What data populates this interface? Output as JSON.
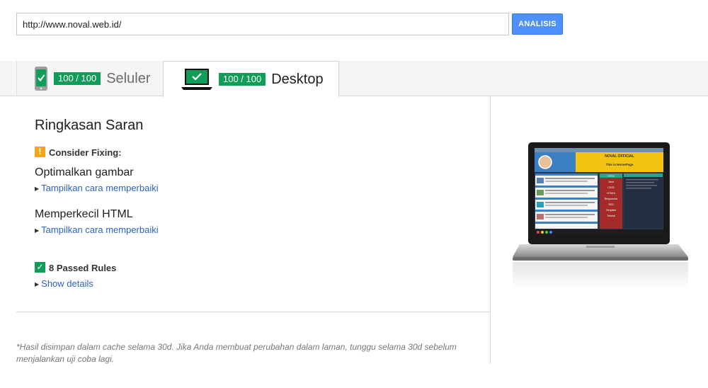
{
  "url_bar": {
    "value": "http://www.noval.web.id/",
    "analyze_label": "ANALISIS"
  },
  "tabs": [
    {
      "id": "mobile",
      "score": "100 / 100",
      "label": "Seluler",
      "active": false
    },
    {
      "id": "desktop",
      "score": "100 / 100",
      "label": "Desktop",
      "active": true
    }
  ],
  "summary": {
    "title": "Ringkasan Saran",
    "consider_label": "Consider Fixing:",
    "rules": [
      {
        "title": "Optimalkan gambar",
        "link": "Tampilkan cara memperbaiki"
      },
      {
        "title": "Memperkecil HTML",
        "link": "Tampilkan cara memperbaiki"
      }
    ],
    "passed_label": "8 Passed Rules",
    "show_details": "Show details"
  },
  "cache_note": "*Hasil disimpan dalam cache selama 30d. Jika Anda membuat perubahan dalam laman, tunggu selama 30d sebelum menjalankan uji coba lagi.",
  "preview_screen": {
    "site_title": "NOVAL OFFICIAL",
    "page_heading": "This is HomePage",
    "nav_items": [
      "Home",
      "Java",
      "CSS3",
      "HTML5",
      "Responsive",
      "SEO",
      "Template",
      "Tutorial"
    ]
  },
  "colors": {
    "accent_blue": "#4d90fe",
    "pass_green": "#0f9d58",
    "warn_orange": "#f4a51c",
    "link_blue": "#2962c4"
  },
  "icons": {
    "mobile_tab": "smartphone-check-icon",
    "desktop_tab": "laptop-check-icon",
    "warning": "exclamation-icon",
    "passed": "checkmark-icon",
    "expand": "triangle-right-icon"
  }
}
